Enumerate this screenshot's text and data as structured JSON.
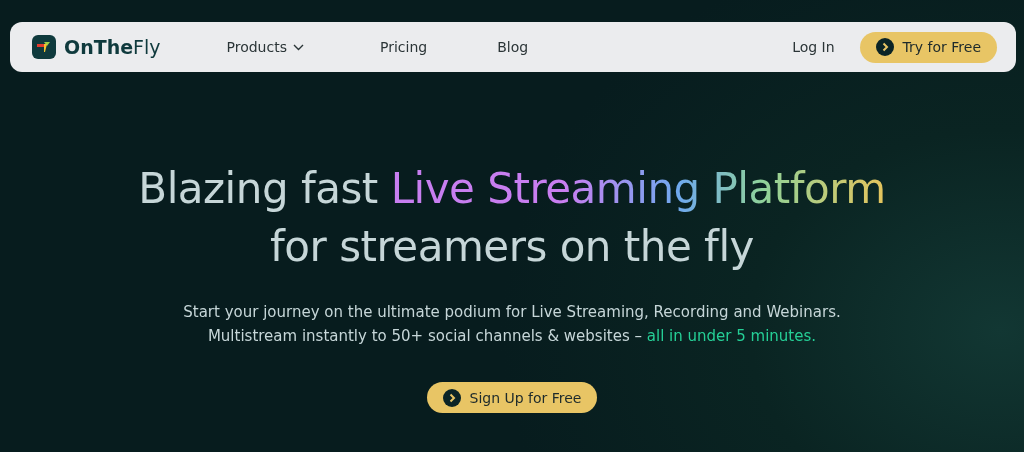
{
  "nav": {
    "logo": "**OnThe**Fly",
    "links": [
      {
        "label": "Products",
        "has_menu": true
      },
      {
        "label": "Pricing",
        "has_menu": false
      },
      {
        "label": "Blog",
        "has_menu": false
      }
    ],
    "login": "Log In",
    "cta": "Try for Free"
  },
  "hero": {
    "headline_start": "Blazing fast ",
    "headline_highlight": "Live Streaming Platform",
    "headline_line_2": "for streamers on the fly",
    "subtitle_line_1": "Start your journey on the ultimate podium for Live Streaming, Recording and Webinars.",
    "subtitle_line_2": "Multistream instantly to 50+ social channels & websites – ",
    "subtitle_accent": "all in under 5 minutes.",
    "cta": "Sign Up for Free"
  }
}
